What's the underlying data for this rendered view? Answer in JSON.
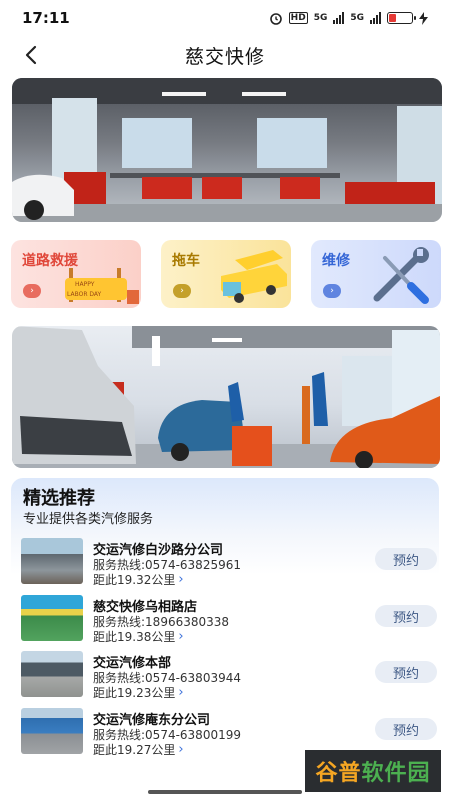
{
  "status_bar": {
    "time": "17:11",
    "hd": "HD",
    "net1": "5G",
    "net2": "5G"
  },
  "nav": {
    "title": "慈交快修"
  },
  "services": [
    {
      "label": "道路救援",
      "icon": "roadside-rescue-icon"
    },
    {
      "label": "拖车",
      "icon": "tow-truck-icon"
    },
    {
      "label": "维修",
      "icon": "wrench-screwdriver-icon"
    }
  ],
  "badge": {
    "happy": "HAPPY",
    "labor_day": "LABOR DAY"
  },
  "recommend": {
    "title": "精选推荐",
    "subtitle": "专业提供各类汽修服务",
    "shops": [
      {
        "name": "交运汽修白沙路分公司",
        "phone": "服务热线:0574-63825961",
        "distance": "距此19.32公里",
        "book": "预约"
      },
      {
        "name": "慈交快修乌相路店",
        "phone": "服务热线:18966380338",
        "distance": "距此19.38公里",
        "book": "预约"
      },
      {
        "name": "交运汽修本部",
        "phone": "服务热线:0574-63803944",
        "distance": "距此19.23公里",
        "book": "预约"
      },
      {
        "name": "交运汽修庵东分公司",
        "phone": "服务热线:0574-63800199",
        "distance": "距此19.27公里",
        "book": "预约"
      }
    ]
  },
  "watermark": {
    "part1": "谷普",
    "part2": "软件园"
  },
  "colors": {
    "accent": "#3566d6",
    "rescue": "#e0473a",
    "tow": "#a87a00"
  }
}
